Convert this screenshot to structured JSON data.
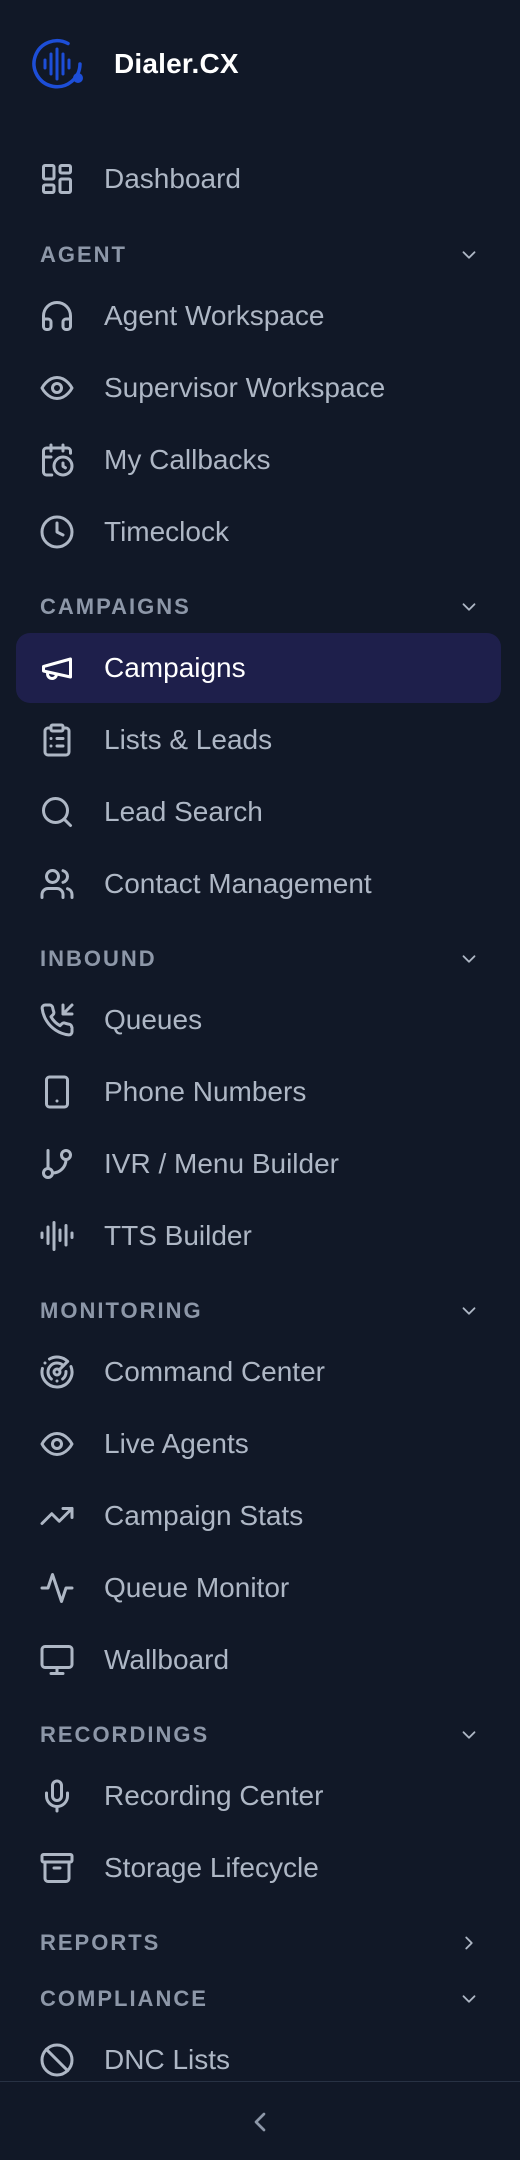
{
  "app": {
    "name": "Dialer.CX"
  },
  "colors": {
    "background": "#111827",
    "active_bg": "#1e1f4b",
    "brand_blue": "#1d4ed8",
    "text": "#aeb7c5",
    "section": "#8d97a8"
  },
  "nav": {
    "dashboard": {
      "label": "Dashboard",
      "icon": "dashboard-icon"
    },
    "sections": [
      {
        "title": "AGENT",
        "expanded": true,
        "items": [
          {
            "label": "Agent Workspace",
            "icon": "headset-icon"
          },
          {
            "label": "Supervisor Workspace",
            "icon": "eye-icon"
          },
          {
            "label": "My Callbacks",
            "icon": "calendar-clock-icon"
          },
          {
            "label": "Timeclock",
            "icon": "clock-icon"
          }
        ]
      },
      {
        "title": "CAMPAIGNS",
        "expanded": true,
        "items": [
          {
            "label": "Campaigns",
            "icon": "megaphone-icon",
            "active": true
          },
          {
            "label": "Lists & Leads",
            "icon": "clipboard-list-icon"
          },
          {
            "label": "Lead Search",
            "icon": "search-icon"
          },
          {
            "label": "Contact Management",
            "icon": "users-icon"
          }
        ]
      },
      {
        "title": "INBOUND",
        "expanded": true,
        "items": [
          {
            "label": "Queues",
            "icon": "phone-incoming-icon"
          },
          {
            "label": "Phone Numbers",
            "icon": "smartphone-icon"
          },
          {
            "label": "IVR / Menu Builder",
            "icon": "git-branch-icon"
          },
          {
            "label": "TTS Builder",
            "icon": "audio-lines-icon"
          }
        ]
      },
      {
        "title": "MONITORING",
        "expanded": true,
        "items": [
          {
            "label": "Command Center",
            "icon": "radar-icon"
          },
          {
            "label": "Live Agents",
            "icon": "eye-icon"
          },
          {
            "label": "Campaign Stats",
            "icon": "trending-up-icon"
          },
          {
            "label": "Queue Monitor",
            "icon": "activity-icon"
          },
          {
            "label": "Wallboard",
            "icon": "monitor-icon"
          }
        ]
      },
      {
        "title": "RECORDINGS",
        "expanded": true,
        "items": [
          {
            "label": "Recording Center",
            "icon": "microphone-icon"
          },
          {
            "label": "Storage Lifecycle",
            "icon": "archive-icon"
          }
        ]
      },
      {
        "title": "REPORTS",
        "expanded": false,
        "items": []
      },
      {
        "title": "COMPLIANCE",
        "expanded": true,
        "items": [
          {
            "label": "DNC Lists",
            "icon": "ban-icon"
          }
        ]
      }
    ]
  },
  "footer": {
    "collapse_icon": "chevron-left-icon"
  }
}
